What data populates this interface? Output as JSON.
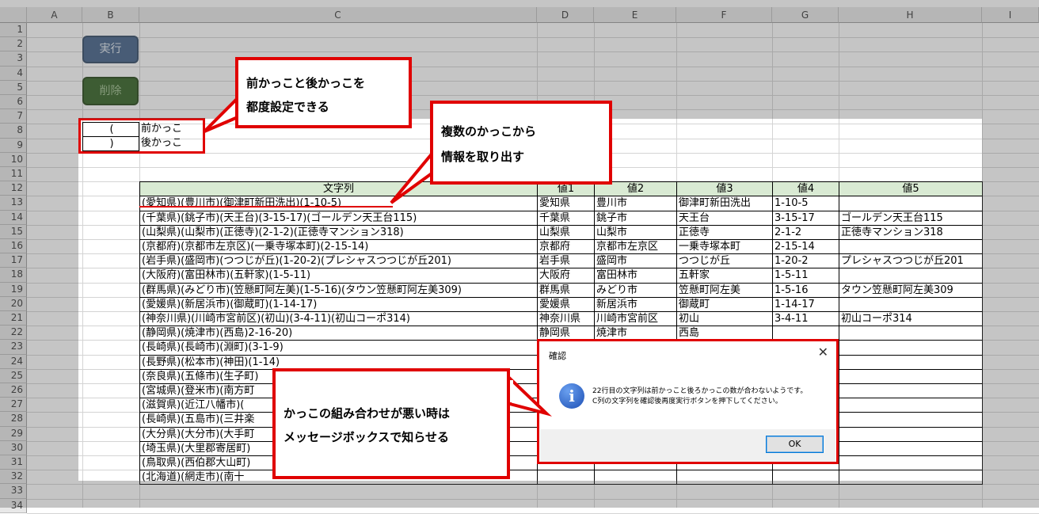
{
  "columns": [
    "A",
    "B",
    "C",
    "D",
    "E",
    "F",
    "G",
    "H",
    "I"
  ],
  "rows": [
    "1",
    "2",
    "3",
    "4",
    "5",
    "6",
    "7",
    "8",
    "9",
    "10",
    "11",
    "12",
    "13",
    "14",
    "15",
    "16",
    "17",
    "18",
    "19",
    "20",
    "21",
    "22",
    "23",
    "24",
    "25",
    "26",
    "27",
    "28",
    "29",
    "30",
    "31",
    "32",
    "33",
    "34"
  ],
  "buttons": {
    "execute": "実行",
    "delete": "削除"
  },
  "settings": [
    {
      "symbol": "(",
      "label": "前かっこ"
    },
    {
      "symbol": ")",
      "label": "後かっこ"
    }
  ],
  "table": {
    "headers": [
      "文字列",
      "値1",
      "値2",
      "値3",
      "値4",
      "値5"
    ],
    "rows": [
      [
        "(愛知県)(豊川市)(御津町新田洗出)(1-10-5)",
        "愛知県",
        "豊川市",
        "御津町新田洗出",
        "1-10-5",
        ""
      ],
      [
        "(千葉県)(銚子市)(天王台)(3-15-17)(ゴールデン天王台115)",
        "千葉県",
        "銚子市",
        "天王台",
        "3-15-17",
        "ゴールデン天王台115"
      ],
      [
        "(山梨県)(山梨市)(正徳寺)(2-1-2)(正徳寺マンション318)",
        "山梨県",
        "山梨市",
        "正徳寺",
        "2-1-2",
        "正徳寺マンション318"
      ],
      [
        "(京都府)(京都市左京区)(一乗寺塚本町)(2-15-14)",
        "京都府",
        "京都市左京区",
        "一乗寺塚本町",
        "2-15-14",
        ""
      ],
      [
        "(岩手県)(盛岡市)(つつじが丘)(1-20-2)(プレシャスつつじが丘201)",
        "岩手県",
        "盛岡市",
        "つつじが丘",
        "1-20-2",
        "プレシャスつつじが丘201"
      ],
      [
        "(大阪府)(富田林市)(五軒家)(1-5-11)",
        "大阪府",
        "富田林市",
        "五軒家",
        "1-5-11",
        ""
      ],
      [
        "(群馬県)(みどり市)(笠懸町阿左美)(1-5-16)(タウン笠懸町阿左美309)",
        "群馬県",
        "みどり市",
        "笠懸町阿左美",
        "1-5-16",
        "タウン笠懸町阿左美309"
      ],
      [
        "(愛媛県)(新居浜市)(御蔵町)(1-14-17)",
        "愛媛県",
        "新居浜市",
        "御蔵町",
        "1-14-17",
        ""
      ],
      [
        "(神奈川県)(川崎市宮前区)(初山)(3-4-11)(初山コーポ314)",
        "神奈川県",
        "川崎市宮前区",
        "初山",
        "3-4-11",
        "初山コーポ314"
      ],
      [
        "(静岡県)(焼津市)(西島)2-16-20)",
        "静岡県",
        "焼津市",
        "西島",
        "",
        ""
      ],
      [
        "(長崎県)(長崎市)(淵町)(3-1-9)",
        "",
        "",
        "",
        "",
        ""
      ],
      [
        "(長野県)(松本市)(神田)(1-14)",
        "",
        "",
        "",
        "",
        ""
      ],
      [
        "(奈良県)(五條市)(生子町)",
        "",
        "",
        "",
        "",
        ""
      ],
      [
        "(宮城県)(登米市)(南方町",
        "",
        "",
        "",
        "",
        ""
      ],
      [
        "(滋賀県)(近江八幡市)(",
        "",
        "",
        "",
        "",
        ""
      ],
      [
        "(長崎県)(五島市)(三井楽",
        "",
        "",
        "",
        "",
        ""
      ],
      [
        "(大分県)(大分市)(大手町",
        "",
        "",
        "",
        "",
        ""
      ],
      [
        "(埼玉県)(大里郡寄居町)",
        "",
        "",
        "",
        "",
        ""
      ],
      [
        "(鳥取県)(西伯郡大山町)",
        "",
        "",
        "",
        "",
        ""
      ],
      [
        "(北海道)(網走市)(南十",
        "",
        "",
        "",
        "",
        ""
      ]
    ]
  },
  "callouts": {
    "brackets": [
      "前かっこと後かっこを",
      "都度設定できる"
    ],
    "extract": [
      "複数のかっこから",
      "情報を取り出す"
    ],
    "mismatch": [
      "かっこの組み合わせが悪い時は",
      "メッセージボックスで知らせる"
    ]
  },
  "dialog": {
    "title": "確認",
    "close": "✕",
    "icon": "info-icon",
    "message_line1": "22行目の文字列は前かっこと後ろかっこの数が合わないようです。",
    "message_line2": "C列の文字列を確認後再度実行ボタンを押下してください。",
    "ok": "OK"
  },
  "colors": {
    "accent": "#e00000",
    "table_header": "#d9ead3",
    "execute_button": "#3f5f86",
    "delete_button": "#2f5e1f"
  }
}
